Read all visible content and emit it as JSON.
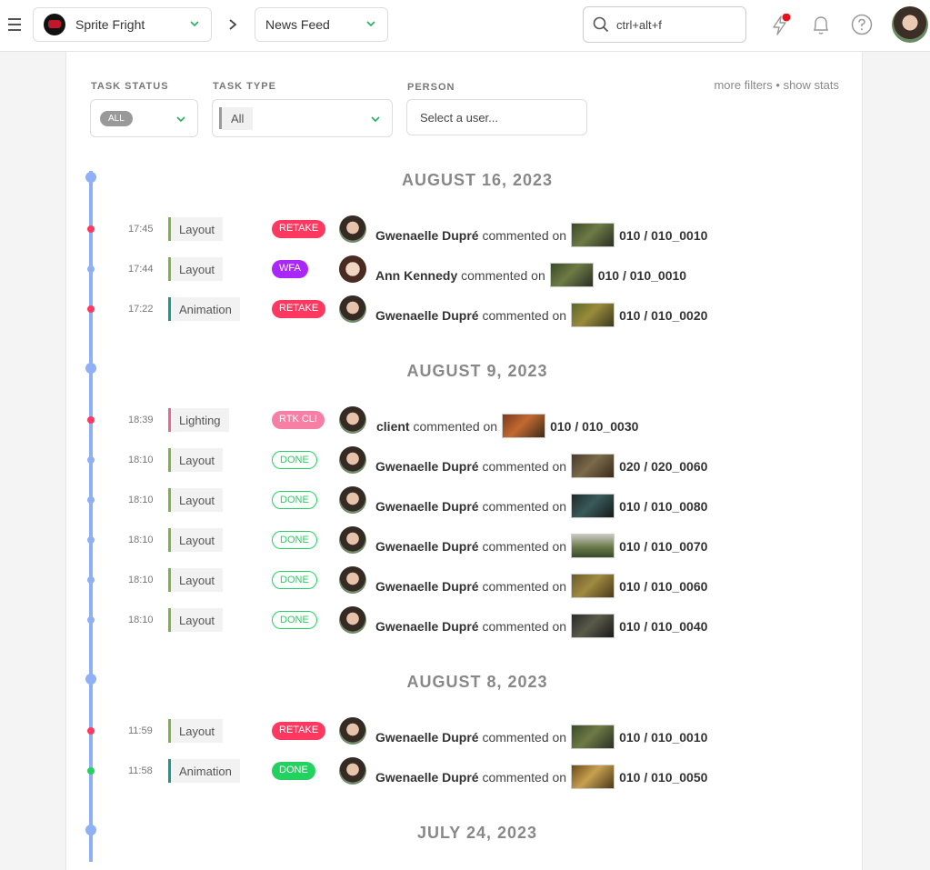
{
  "topbar": {
    "production": "Sprite Fright",
    "section": "News Feed",
    "search_placeholder": "ctrl+alt+f"
  },
  "filters": {
    "task_status_label": "TASK STATUS",
    "task_status_value": "ALL",
    "task_type_label": "TASK TYPE",
    "task_type_value": "All",
    "person_label": "PERSON",
    "person_placeholder": "Select a user...",
    "more_filters": "more filters",
    "separator": "•",
    "show_stats": "show stats"
  },
  "colors": {
    "timeline": "#8fb0f5",
    "retake": "#ff3860",
    "wfa": "#ab26fa",
    "rtk_cli": "#f77fa5",
    "done": "#22d160",
    "layout": "#7db34a",
    "animation": "#1a9988",
    "lighting": "#e56a8f"
  },
  "groups": [
    {
      "date": "AUGUST 16, 2023",
      "entries": [
        {
          "time": "17:45",
          "task_type": "Layout",
          "status": "RETAKE",
          "person": "Gwenaelle Dupré",
          "verb": "commented on",
          "entity": "010 / 010_0010"
        },
        {
          "time": "17:44",
          "task_type": "Layout",
          "status": "WFA",
          "person": "Ann Kennedy",
          "verb": "commented on",
          "entity": "010 / 010_0010"
        },
        {
          "time": "17:22",
          "task_type": "Animation",
          "status": "RETAKE",
          "person": "Gwenaelle Dupré",
          "verb": "commented on",
          "entity": "010 / 010_0020"
        }
      ]
    },
    {
      "date": "AUGUST 9, 2023",
      "entries": [
        {
          "time": "18:39",
          "task_type": "Lighting",
          "status": "RTK CLI",
          "person": "client",
          "verb": "commented on",
          "entity": "010 / 010_0030"
        },
        {
          "time": "18:10",
          "task_type": "Layout",
          "status": "DONE",
          "person": "Gwenaelle Dupré",
          "verb": "commented on",
          "entity": "020 / 020_0060"
        },
        {
          "time": "18:10",
          "task_type": "Layout",
          "status": "DONE",
          "person": "Gwenaelle Dupré",
          "verb": "commented on",
          "entity": "010 / 010_0080"
        },
        {
          "time": "18:10",
          "task_type": "Layout",
          "status": "DONE",
          "person": "Gwenaelle Dupré",
          "verb": "commented on",
          "entity": "010 / 010_0070"
        },
        {
          "time": "18:10",
          "task_type": "Layout",
          "status": "DONE",
          "person": "Gwenaelle Dupré",
          "verb": "commented on",
          "entity": "010 / 010_0060"
        },
        {
          "time": "18:10",
          "task_type": "Layout",
          "status": "DONE",
          "person": "Gwenaelle Dupré",
          "verb": "commented on",
          "entity": "010 / 010_0040"
        }
      ]
    },
    {
      "date": "AUGUST 8, 2023",
      "entries": [
        {
          "time": "11:59",
          "task_type": "Layout",
          "status": "RETAKE",
          "person": "Gwenaelle Dupré",
          "verb": "commented on",
          "entity": "010 / 010_0010"
        },
        {
          "time": "11:58",
          "task_type": "Animation",
          "status": "DONE",
          "person": "Gwenaelle Dupré",
          "verb": "commented on",
          "entity": "010 / 010_0050"
        }
      ]
    },
    {
      "date": "JULY 24, 2023",
      "entries": []
    }
  ]
}
